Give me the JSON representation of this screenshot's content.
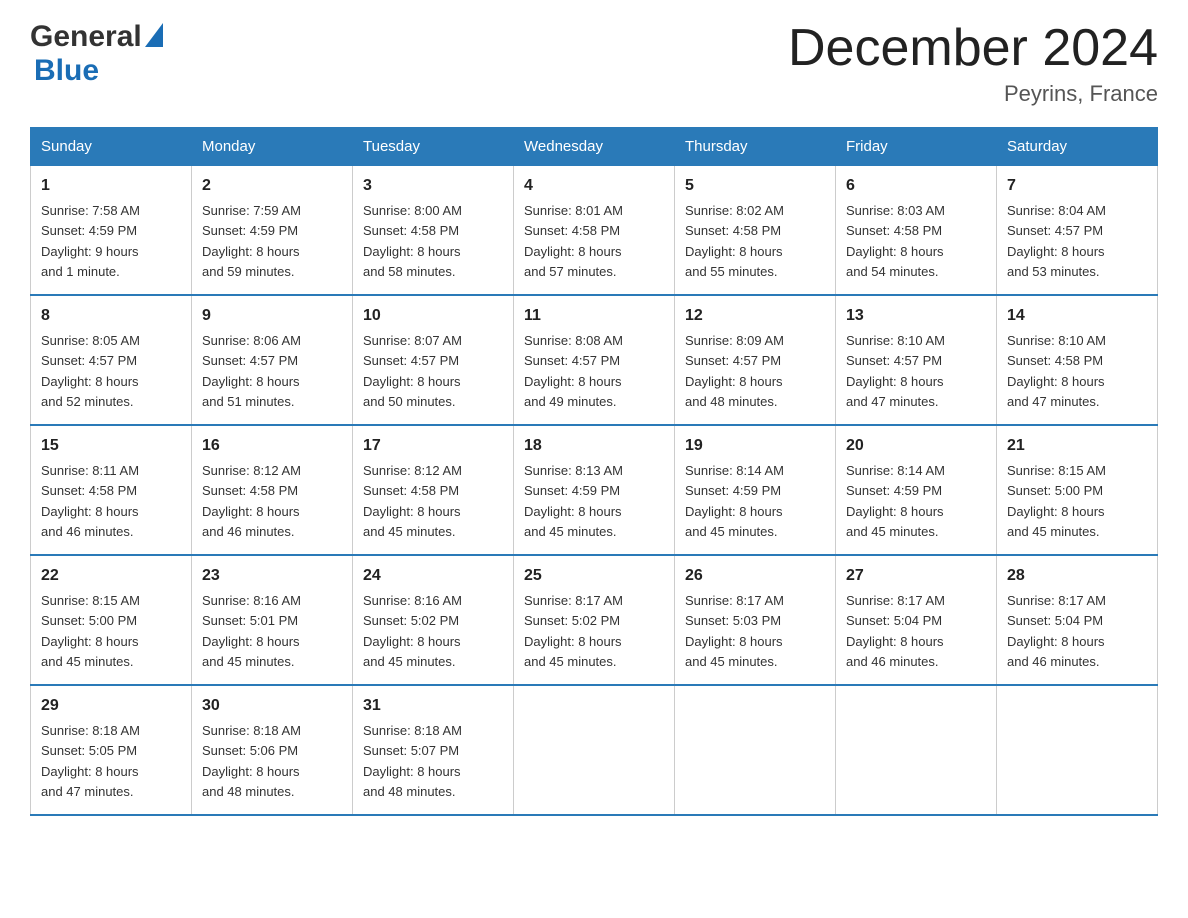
{
  "header": {
    "logo_general": "General",
    "logo_blue": "Blue",
    "month_title": "December 2024",
    "location": "Peyrins, France"
  },
  "columns": [
    "Sunday",
    "Monday",
    "Tuesday",
    "Wednesday",
    "Thursday",
    "Friday",
    "Saturday"
  ],
  "weeks": [
    [
      {
        "day": "1",
        "sunrise": "Sunrise: 7:58 AM",
        "sunset": "Sunset: 4:59 PM",
        "daylight": "Daylight: 9 hours",
        "daylight2": "and 1 minute."
      },
      {
        "day": "2",
        "sunrise": "Sunrise: 7:59 AM",
        "sunset": "Sunset: 4:59 PM",
        "daylight": "Daylight: 8 hours",
        "daylight2": "and 59 minutes."
      },
      {
        "day": "3",
        "sunrise": "Sunrise: 8:00 AM",
        "sunset": "Sunset: 4:58 PM",
        "daylight": "Daylight: 8 hours",
        "daylight2": "and 58 minutes."
      },
      {
        "day": "4",
        "sunrise": "Sunrise: 8:01 AM",
        "sunset": "Sunset: 4:58 PM",
        "daylight": "Daylight: 8 hours",
        "daylight2": "and 57 minutes."
      },
      {
        "day": "5",
        "sunrise": "Sunrise: 8:02 AM",
        "sunset": "Sunset: 4:58 PM",
        "daylight": "Daylight: 8 hours",
        "daylight2": "and 55 minutes."
      },
      {
        "day": "6",
        "sunrise": "Sunrise: 8:03 AM",
        "sunset": "Sunset: 4:58 PM",
        "daylight": "Daylight: 8 hours",
        "daylight2": "and 54 minutes."
      },
      {
        "day": "7",
        "sunrise": "Sunrise: 8:04 AM",
        "sunset": "Sunset: 4:57 PM",
        "daylight": "Daylight: 8 hours",
        "daylight2": "and 53 minutes."
      }
    ],
    [
      {
        "day": "8",
        "sunrise": "Sunrise: 8:05 AM",
        "sunset": "Sunset: 4:57 PM",
        "daylight": "Daylight: 8 hours",
        "daylight2": "and 52 minutes."
      },
      {
        "day": "9",
        "sunrise": "Sunrise: 8:06 AM",
        "sunset": "Sunset: 4:57 PM",
        "daylight": "Daylight: 8 hours",
        "daylight2": "and 51 minutes."
      },
      {
        "day": "10",
        "sunrise": "Sunrise: 8:07 AM",
        "sunset": "Sunset: 4:57 PM",
        "daylight": "Daylight: 8 hours",
        "daylight2": "and 50 minutes."
      },
      {
        "day": "11",
        "sunrise": "Sunrise: 8:08 AM",
        "sunset": "Sunset: 4:57 PM",
        "daylight": "Daylight: 8 hours",
        "daylight2": "and 49 minutes."
      },
      {
        "day": "12",
        "sunrise": "Sunrise: 8:09 AM",
        "sunset": "Sunset: 4:57 PM",
        "daylight": "Daylight: 8 hours",
        "daylight2": "and 48 minutes."
      },
      {
        "day": "13",
        "sunrise": "Sunrise: 8:10 AM",
        "sunset": "Sunset: 4:57 PM",
        "daylight": "Daylight: 8 hours",
        "daylight2": "and 47 minutes."
      },
      {
        "day": "14",
        "sunrise": "Sunrise: 8:10 AM",
        "sunset": "Sunset: 4:58 PM",
        "daylight": "Daylight: 8 hours",
        "daylight2": "and 47 minutes."
      }
    ],
    [
      {
        "day": "15",
        "sunrise": "Sunrise: 8:11 AM",
        "sunset": "Sunset: 4:58 PM",
        "daylight": "Daylight: 8 hours",
        "daylight2": "and 46 minutes."
      },
      {
        "day": "16",
        "sunrise": "Sunrise: 8:12 AM",
        "sunset": "Sunset: 4:58 PM",
        "daylight": "Daylight: 8 hours",
        "daylight2": "and 46 minutes."
      },
      {
        "day": "17",
        "sunrise": "Sunrise: 8:12 AM",
        "sunset": "Sunset: 4:58 PM",
        "daylight": "Daylight: 8 hours",
        "daylight2": "and 45 minutes."
      },
      {
        "day": "18",
        "sunrise": "Sunrise: 8:13 AM",
        "sunset": "Sunset: 4:59 PM",
        "daylight": "Daylight: 8 hours",
        "daylight2": "and 45 minutes."
      },
      {
        "day": "19",
        "sunrise": "Sunrise: 8:14 AM",
        "sunset": "Sunset: 4:59 PM",
        "daylight": "Daylight: 8 hours",
        "daylight2": "and 45 minutes."
      },
      {
        "day": "20",
        "sunrise": "Sunrise: 8:14 AM",
        "sunset": "Sunset: 4:59 PM",
        "daylight": "Daylight: 8 hours",
        "daylight2": "and 45 minutes."
      },
      {
        "day": "21",
        "sunrise": "Sunrise: 8:15 AM",
        "sunset": "Sunset: 5:00 PM",
        "daylight": "Daylight: 8 hours",
        "daylight2": "and 45 minutes."
      }
    ],
    [
      {
        "day": "22",
        "sunrise": "Sunrise: 8:15 AM",
        "sunset": "Sunset: 5:00 PM",
        "daylight": "Daylight: 8 hours",
        "daylight2": "and 45 minutes."
      },
      {
        "day": "23",
        "sunrise": "Sunrise: 8:16 AM",
        "sunset": "Sunset: 5:01 PM",
        "daylight": "Daylight: 8 hours",
        "daylight2": "and 45 minutes."
      },
      {
        "day": "24",
        "sunrise": "Sunrise: 8:16 AM",
        "sunset": "Sunset: 5:02 PM",
        "daylight": "Daylight: 8 hours",
        "daylight2": "and 45 minutes."
      },
      {
        "day": "25",
        "sunrise": "Sunrise: 8:17 AM",
        "sunset": "Sunset: 5:02 PM",
        "daylight": "Daylight: 8 hours",
        "daylight2": "and 45 minutes."
      },
      {
        "day": "26",
        "sunrise": "Sunrise: 8:17 AM",
        "sunset": "Sunset: 5:03 PM",
        "daylight": "Daylight: 8 hours",
        "daylight2": "and 45 minutes."
      },
      {
        "day": "27",
        "sunrise": "Sunrise: 8:17 AM",
        "sunset": "Sunset: 5:04 PM",
        "daylight": "Daylight: 8 hours",
        "daylight2": "and 46 minutes."
      },
      {
        "day": "28",
        "sunrise": "Sunrise: 8:17 AM",
        "sunset": "Sunset: 5:04 PM",
        "daylight": "Daylight: 8 hours",
        "daylight2": "and 46 minutes."
      }
    ],
    [
      {
        "day": "29",
        "sunrise": "Sunrise: 8:18 AM",
        "sunset": "Sunset: 5:05 PM",
        "daylight": "Daylight: 8 hours",
        "daylight2": "and 47 minutes."
      },
      {
        "day": "30",
        "sunrise": "Sunrise: 8:18 AM",
        "sunset": "Sunset: 5:06 PM",
        "daylight": "Daylight: 8 hours",
        "daylight2": "and 48 minutes."
      },
      {
        "day": "31",
        "sunrise": "Sunrise: 8:18 AM",
        "sunset": "Sunset: 5:07 PM",
        "daylight": "Daylight: 8 hours",
        "daylight2": "and 48 minutes."
      },
      null,
      null,
      null,
      null
    ]
  ]
}
